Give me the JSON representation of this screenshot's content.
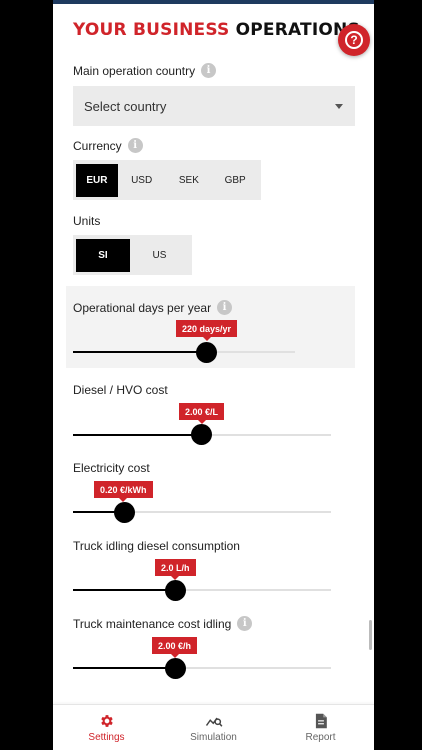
{
  "header": {
    "title_red": "YOUR BUSINESS",
    "title_dark": "OPERATIONS",
    "help_icon": "help-icon",
    "accent_color": "#d0242a"
  },
  "country": {
    "label": "Main operation country",
    "placeholder": "Select country"
  },
  "currency": {
    "label": "Currency",
    "options": [
      "EUR",
      "USD",
      "SEK",
      "GBP"
    ],
    "selected": "EUR"
  },
  "units": {
    "label": "Units",
    "options": [
      "SI",
      "US"
    ],
    "selected": "SI"
  },
  "sliders": {
    "operational_days": {
      "label": "Operational days per year",
      "value_label": "220 days/yr",
      "fraction": 0.6
    },
    "diesel_cost": {
      "label": "Diesel / HVO cost",
      "value_label": "2.00 €/L",
      "fraction": 0.5
    },
    "electricity_cost": {
      "label": "Electricity cost",
      "value_label": "0.20 €/kWh",
      "fraction": 0.2
    },
    "idling_consumption": {
      "label": "Truck idling diesel consumption",
      "value_label": "2.0 L/h",
      "fraction": 0.4
    },
    "maintenance_cost": {
      "label": "Truck maintenance cost idling",
      "value_label": "2.00 €/h",
      "fraction": 0.4
    }
  },
  "nav": {
    "items": [
      {
        "label": "Settings",
        "icon": "gear-icon",
        "active": true
      },
      {
        "label": "Simulation",
        "icon": "chart-search-icon",
        "active": false
      },
      {
        "label": "Report",
        "icon": "document-icon",
        "active": false
      }
    ]
  }
}
